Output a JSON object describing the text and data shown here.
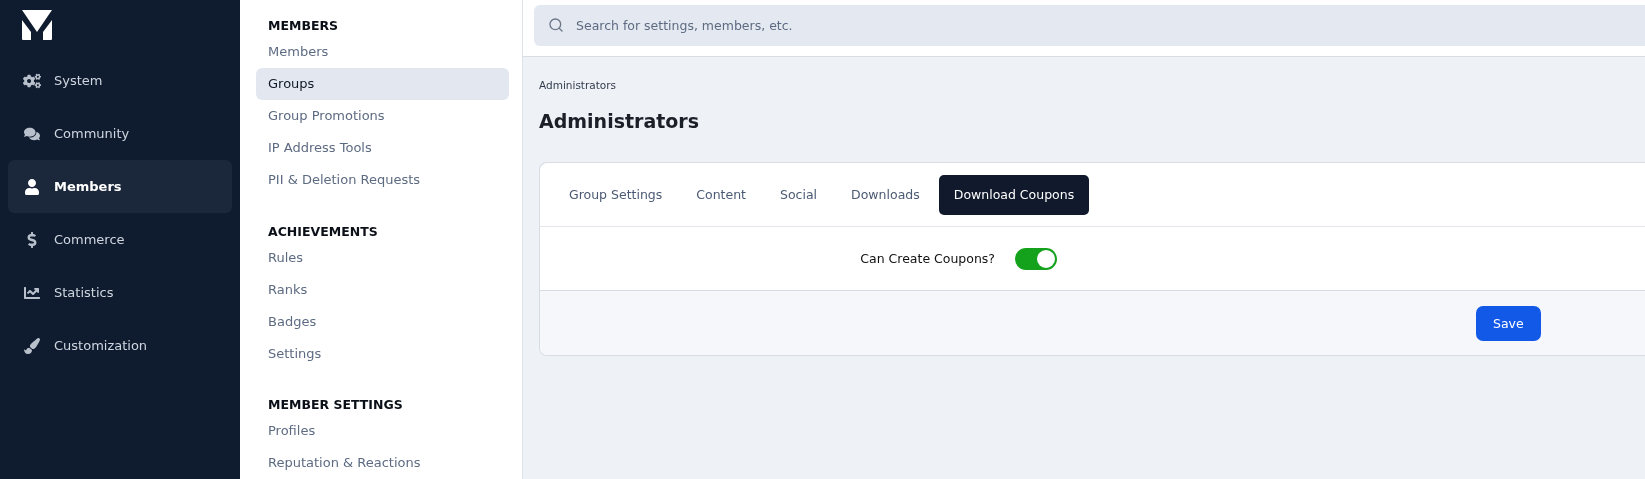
{
  "nav": {
    "items": [
      {
        "label": "System",
        "kind": "system",
        "selected": false
      },
      {
        "label": "Community",
        "kind": "community",
        "selected": false
      },
      {
        "label": "Members",
        "kind": "members",
        "selected": true
      },
      {
        "label": "Commerce",
        "kind": "commerce",
        "selected": false
      },
      {
        "label": "Statistics",
        "kind": "statistics",
        "selected": false
      },
      {
        "label": "Customization",
        "kind": "customization",
        "selected": false
      }
    ]
  },
  "submenu": {
    "sections": [
      {
        "heading": "MEMBERS",
        "items": [
          {
            "label": "Members",
            "selected": false
          },
          {
            "label": "Groups",
            "selected": true
          },
          {
            "label": "Group Promotions",
            "selected": false
          },
          {
            "label": "IP Address Tools",
            "selected": false
          },
          {
            "label": "PII & Deletion Requests",
            "selected": false
          }
        ]
      },
      {
        "heading": "ACHIEVEMENTS",
        "items": [
          {
            "label": "Rules",
            "selected": false
          },
          {
            "label": "Ranks",
            "selected": false
          },
          {
            "label": "Badges",
            "selected": false
          },
          {
            "label": "Settings",
            "selected": false
          }
        ]
      },
      {
        "heading": "MEMBER SETTINGS",
        "items": [
          {
            "label": "Profiles",
            "selected": false
          },
          {
            "label": "Reputation & Reactions",
            "selected": false
          }
        ]
      }
    ]
  },
  "search": {
    "placeholder": "Search for settings, members, etc."
  },
  "breadcrumb": "Administrators",
  "title": "Administrators",
  "tabs": [
    {
      "label": "Group Settings",
      "selected": false
    },
    {
      "label": "Content",
      "selected": false
    },
    {
      "label": "Social",
      "selected": false
    },
    {
      "label": "Downloads",
      "selected": false
    },
    {
      "label": "Download Coupons",
      "selected": true
    }
  ],
  "settings": [
    {
      "kind": "toggle",
      "label": "Can Create Coupons?",
      "on": true
    }
  ],
  "save_button": "Save"
}
